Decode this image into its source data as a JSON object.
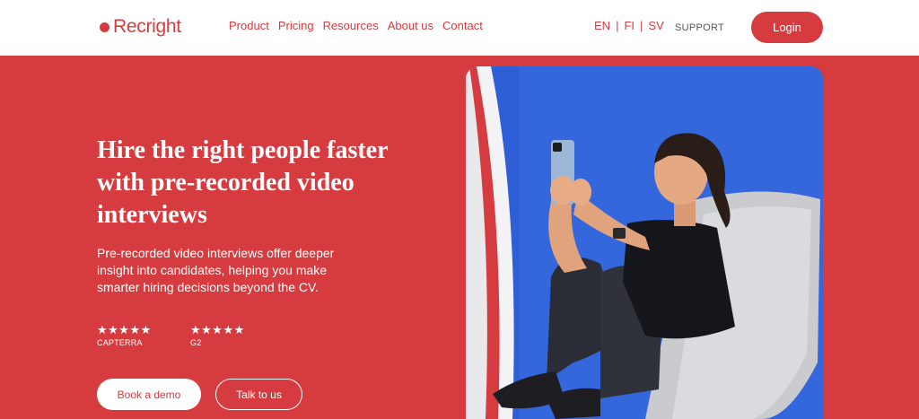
{
  "brand": {
    "name": "Recright",
    "color": "#d63c3f"
  },
  "nav": {
    "items": [
      {
        "label": "Product"
      },
      {
        "label": "Pricing"
      },
      {
        "label": "Resources"
      },
      {
        "label": "About us"
      },
      {
        "label": "Contact"
      }
    ]
  },
  "languages": {
    "items": [
      "EN",
      "FI",
      "SV"
    ],
    "separator": "|"
  },
  "support_label": "SUPPORT",
  "login_label": "Login",
  "hero": {
    "title": "Hire the right people faster with pre-recorded video interviews",
    "subtitle": "Pre-recorded video interviews offer deeper insight into candidates, helping you make smarter hiring decisions beyond the CV.",
    "ratings": [
      {
        "stars": "★★★★★",
        "source": "CAPTERRA"
      },
      {
        "stars": "★★★★★",
        "source": "G2"
      }
    ],
    "primary_cta": "Book a demo",
    "secondary_cta": "Talk to us",
    "image_icon": "woman-recording-selfie-video-photo"
  },
  "colors": {
    "accent": "#d63c3f",
    "photo_backdrop": "#2f5fd6",
    "white": "#ffffff"
  }
}
